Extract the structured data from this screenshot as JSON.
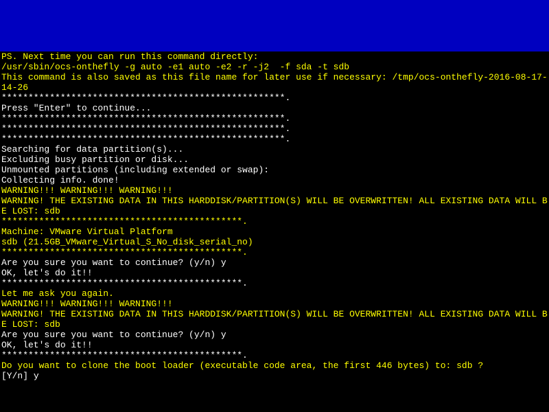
{
  "header": {
    "ps_line": "PS. Next time you can run this command directly:",
    "cmd_line": "/usr/sbin/ocs-onthefly -g auto -e1 auto -e2 -r -j2  -f sda -t sdb",
    "saved_line": "This command is also saved as this file name for later use if necessary: /tmp/ocs-onthefly-2016-08-17-14-26"
  },
  "sep_long": "*****************************************************.",
  "sep_short": "*********************************************.",
  "press_enter": "Press \"Enter\" to continue...",
  "searching": "Searching for data partition(s)...",
  "excluding": "Excluding busy partition or disk...",
  "unmounted": "Unmounted partitions (including extended or swap):",
  "collecting": "Collecting info. done!",
  "warn_triple": "WARNING!!! WARNING!!! WARNING!!!",
  "warn_overwrite": "WARNING! THE EXISTING DATA IN THIS HARDDISK/PARTITION(S) WILL BE OVERWRITTEN! ALL EXISTING DATA WILL BE LOST: sdb",
  "machine": "Machine: VMware Virtual Platform",
  "disk_info": "sdb (21.5GB_VMware_Virtual_S_No_disk_serial_no)",
  "confirm_q": "Are you sure you want to continue? (y/n) y",
  "ok_doit": "OK, let's do it!!",
  "ask_again": "Let me ask you again.",
  "clone_q": "Do you want to clone the boot loader (executable code area, the first 446 bytes) to: sdb ?",
  "prompt": "[Y/n] ",
  "prompt_answer": "y"
}
